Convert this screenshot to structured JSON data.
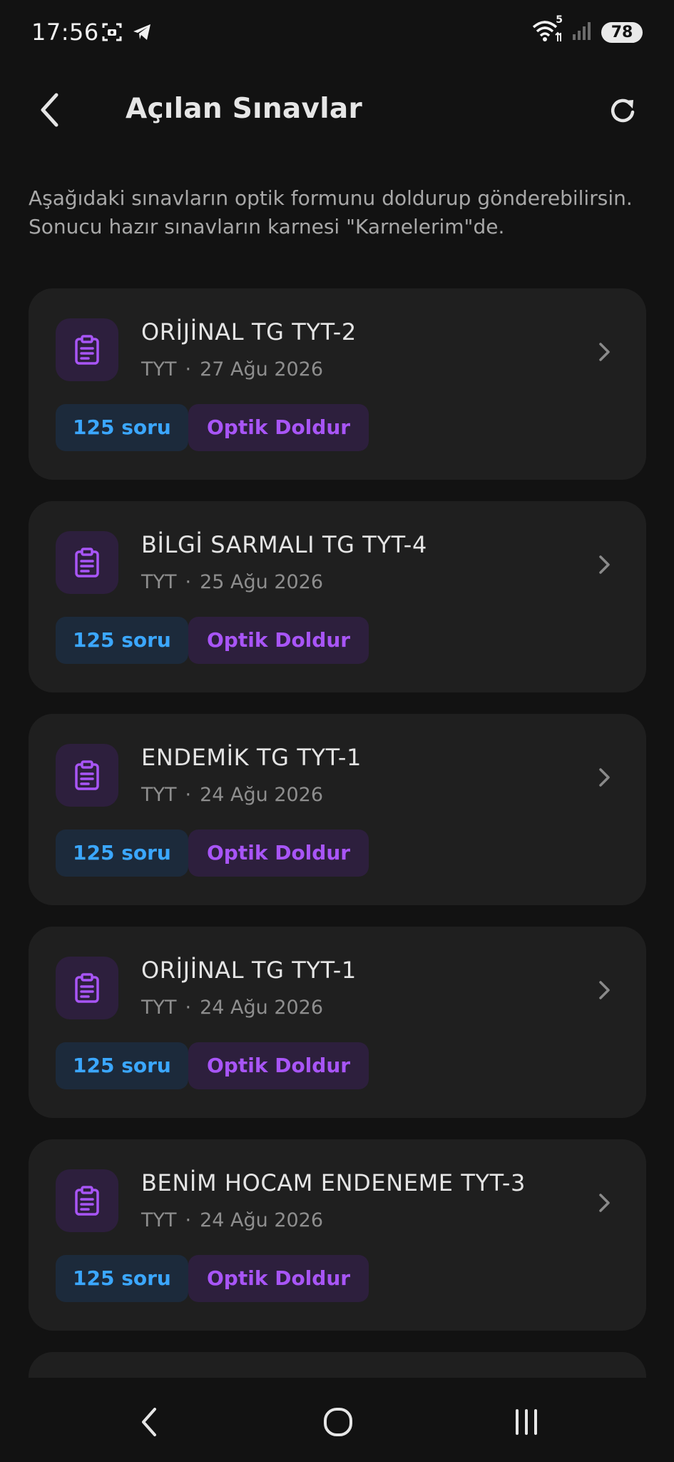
{
  "status_bar": {
    "time": "17:56",
    "wifi_badge": "5",
    "battery": "78",
    "icons": [
      "screenshot-icon",
      "telegram-icon",
      "wifi-icon",
      "signal-icon",
      "battery-icon"
    ]
  },
  "header": {
    "title": "Açılan Sınavlar",
    "back_icon": "chevron-left-icon",
    "refresh_icon": "refresh-icon"
  },
  "intro": "Aşağıdaki sınavların optik formunu doldurup gönderebilirsin. Sonucu hazır sınavların karnesi \"Karnelerim\"de.",
  "exams": [
    {
      "title": "ORİJİNAL TG TYT-2",
      "type": "TYT",
      "separator": "·",
      "date": "27 Ağu 2026",
      "question_count": "125 soru",
      "action": "Optik Doldur"
    },
    {
      "title": "BİLGİ SARMALI TG TYT-4",
      "type": "TYT",
      "separator": "·",
      "date": "25 Ağu 2026",
      "question_count": "125 soru",
      "action": "Optik Doldur"
    },
    {
      "title": "ENDEMİK TG TYT-1",
      "type": "TYT",
      "separator": "·",
      "date": "24 Ağu 2026",
      "question_count": "125 soru",
      "action": "Optik Doldur"
    },
    {
      "title": "ORİJİNAL TG TYT-1",
      "type": "TYT",
      "separator": "·",
      "date": "24 Ağu 2026",
      "question_count": "125 soru",
      "action": "Optik Doldur"
    },
    {
      "title": "BENİM HOCAM ENDENEME TYT-3",
      "type": "TYT",
      "separator": "·",
      "date": "24 Ağu 2026",
      "question_count": "125 soru",
      "action": "Optik Doldur"
    }
  ],
  "colors": {
    "background": "#121212",
    "card": "#1f1f1f",
    "accent_purple": "#a855f7",
    "accent_blue": "#3ba7ff"
  },
  "nav_bar": {
    "icons": [
      "nav-back-icon",
      "nav-home-icon",
      "nav-recents-icon"
    ]
  }
}
